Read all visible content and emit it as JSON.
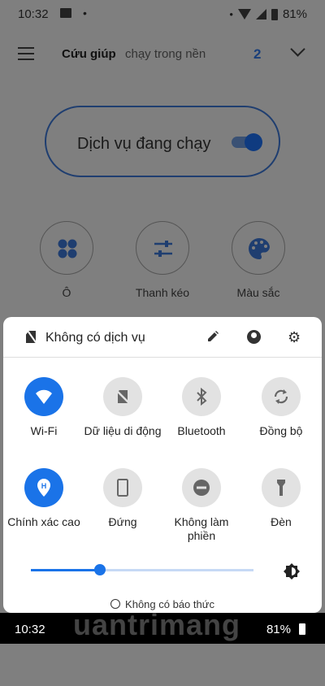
{
  "status_bar": {
    "time": "10:32",
    "battery": "81%"
  },
  "app": {
    "tab_active": "Cứu giúp",
    "tab_other": "chạy trong nền",
    "count": "2",
    "running_label": "Dịch vụ đang chạy",
    "running_toggle_on": true,
    "features": [
      {
        "label": "Ô",
        "icon": "grid-icon"
      },
      {
        "label": "Thanh kéo",
        "icon": "sliders-icon"
      },
      {
        "label": "Màu sắc",
        "icon": "palette-icon"
      }
    ]
  },
  "quick_settings": {
    "header_text": "Không có dịch vụ",
    "tiles": [
      {
        "label": "Wi-Fi",
        "icon": "wifi-icon",
        "active": true
      },
      {
        "label": "Dữ liệu di động",
        "icon": "mobile-data-off-icon",
        "active": false
      },
      {
        "label": "Bluetooth",
        "icon": "bluetooth-icon",
        "active": false
      },
      {
        "label": "Đồng bộ",
        "icon": "sync-icon",
        "active": false
      },
      {
        "label": "Chính xác cao",
        "icon": "location-high-accuracy-icon",
        "active": true
      },
      {
        "label": "Đứng",
        "icon": "portrait-icon",
        "active": false
      },
      {
        "label": "Không làm phiền",
        "icon": "do-not-disturb-icon",
        "active": false
      },
      {
        "label": "Đèn",
        "icon": "flashlight-icon",
        "active": false
      }
    ],
    "brightness_level": 0.31,
    "alarm_text": "Không có báo thức"
  },
  "bottom_bar": {
    "time": "10:32",
    "battery": "81%"
  },
  "watermark": "uantrimang",
  "colors": {
    "accent": "#1a73e8",
    "dim_background": "#7f7f7f"
  }
}
